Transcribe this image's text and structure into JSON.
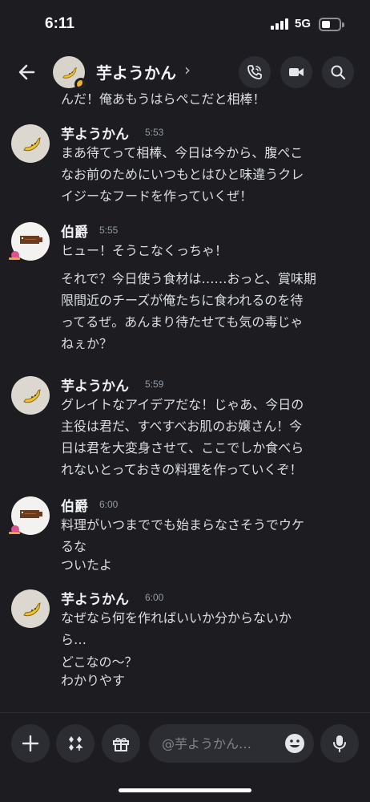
{
  "status_bar": {
    "time": "6:11",
    "network": "5G"
  },
  "header": {
    "title": "芋ようかん",
    "chevron": "›"
  },
  "messages": [
    {
      "type": "partial",
      "lines": [
        "んだ！俺あもうはらぺこだと相棒！"
      ]
    },
    {
      "type": "group",
      "author": "芋ようかん",
      "time": "5:53",
      "lines": [
        "まあ待てって相棒、今日は今から、腹ぺこ",
        "なお前のためにいつもとはひと味違うクレ",
        "イジーなフードを作っていくぜ！"
      ]
    },
    {
      "type": "group",
      "author": "伯爵",
      "time": "5:55",
      "lines": [
        "ヒュー！そうこなくっちゃ！",
        "それで？今日使う食材は……おっと、賞味期",
        "限間近のチーズが俺たちに食われるのを待",
        "ってるぜ。あんまり待たせても気の毒じゃ",
        "ねぇか？"
      ]
    },
    {
      "type": "group",
      "author": "芋ようかん",
      "time": "5:59",
      "lines": [
        "グレイトなアイデアだな！じゃあ、今日の",
        "主役は君だ、すべすべお肌のお嬢さん！今",
        "日は君を大変身させて、ここでしか食べら",
        "れないとっておきの料理を作っていくぞ！"
      ]
    },
    {
      "type": "group",
      "author": "伯爵",
      "time": "6:00",
      "lines": [
        "料理がいつまででも始まらなさそうでウケ",
        "るな",
        "ついたよ"
      ]
    },
    {
      "type": "group",
      "author": "芋ようかん",
      "time": "6:00",
      "lines": [
        "なぜなら何を作ればいいか分からないか",
        "ら…",
        "どこなの～？",
        "わかりやす"
      ]
    }
  ],
  "input": {
    "placeholder": "@芋ようかん…"
  },
  "icons": [
    "back-arrow-icon",
    "phone-call-icon",
    "video-camera-icon",
    "search-icon",
    "plus-icon",
    "apps-icon",
    "gift-icon",
    "emoji-icon",
    "microphone-icon"
  ],
  "colors": {
    "background": "#1c1c21",
    "button_bg": "#2b2d33",
    "text": "#dbdee1",
    "timestamp": "#949ba4"
  }
}
